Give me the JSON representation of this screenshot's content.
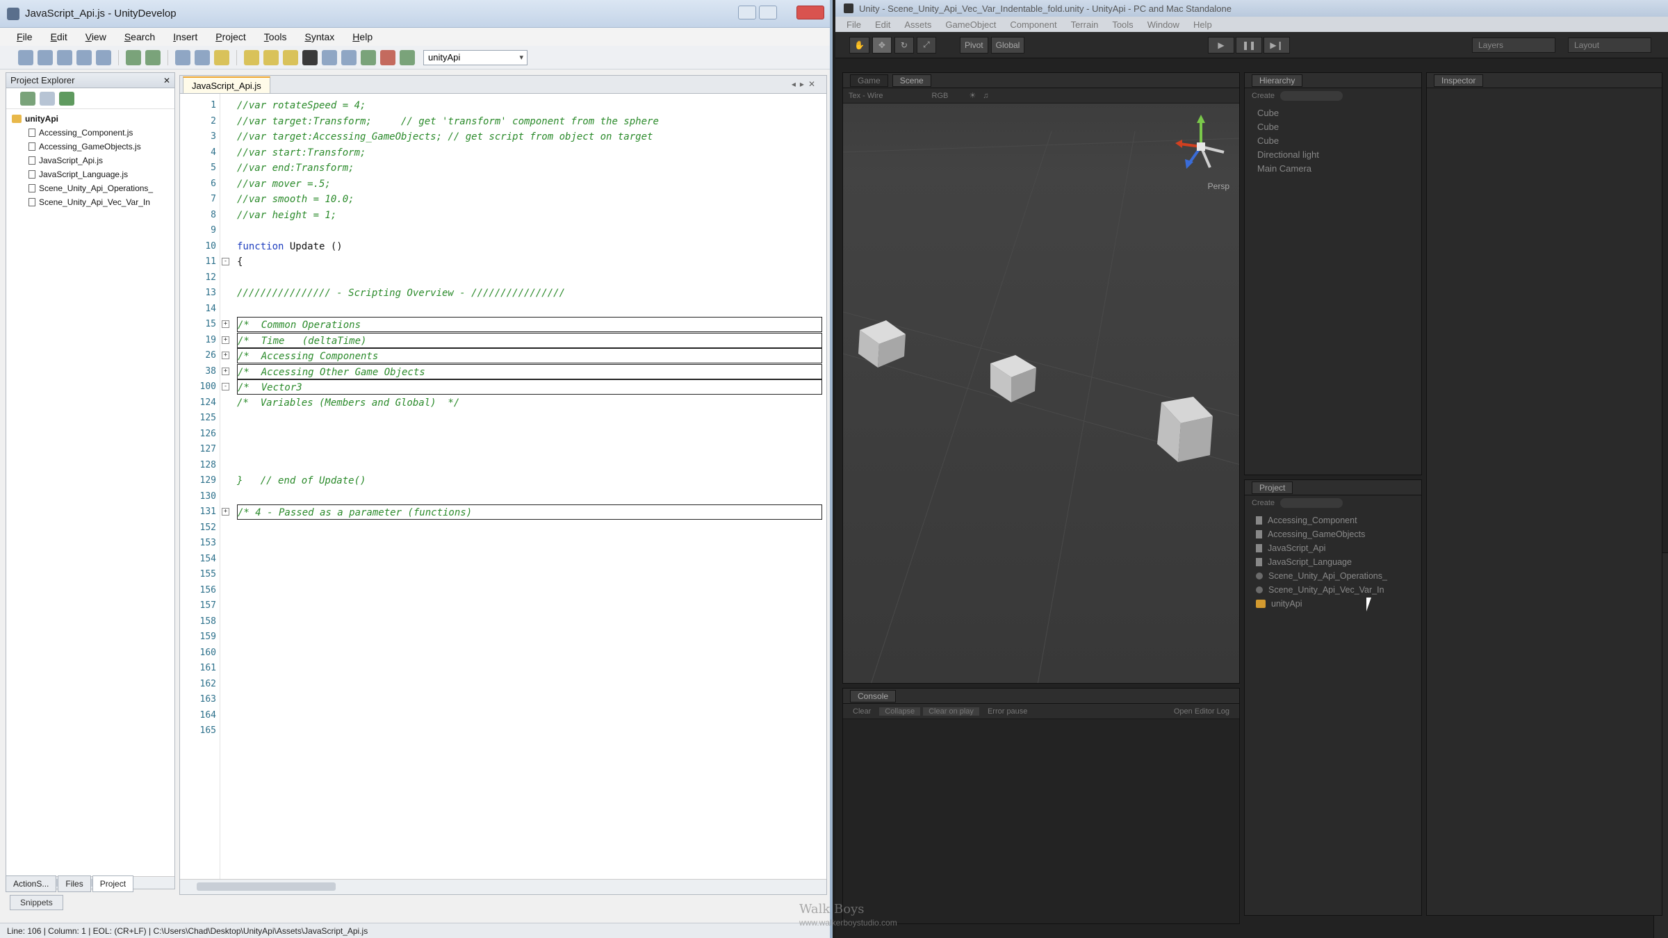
{
  "editor_window": {
    "title": "JavaScript_Api.js - UnityDevelop",
    "menu": [
      "File",
      "Edit",
      "View",
      "Search",
      "Insert",
      "Project",
      "Tools",
      "Syntax",
      "Help"
    ],
    "target_combo": "unityApi",
    "project_explorer": {
      "title": "Project Explorer",
      "root": "unityApi",
      "files": [
        "Accessing_Component.js",
        "Accessing_GameObjects.js",
        "JavaScript_Api.js",
        "JavaScript_Language.js",
        "Scene_Unity_Api_Operations_",
        "Scene_Unity_Api_Vec_Var_In"
      ]
    },
    "bottom_tabs": [
      "ActionS...",
      "Files",
      "Project"
    ],
    "snippets_tab": "Snippets",
    "tab": "JavaScript_Api.js",
    "code_lines": [
      {
        "n": "1",
        "text": "//var rotateSpeed = 4;",
        "kind": "comment"
      },
      {
        "n": "2",
        "text": "//var target:Transform;     // get 'transform' component from the sphere",
        "kind": "comment"
      },
      {
        "n": "3",
        "text": "//var target:Accessing_GameObjects; // get script from object on target",
        "kind": "comment"
      },
      {
        "n": "4",
        "text": "//var start:Transform;",
        "kind": "comment"
      },
      {
        "n": "5",
        "text": "//var end:Transform;",
        "kind": "comment"
      },
      {
        "n": "6",
        "text": "//var mover =.5;",
        "kind": "comment"
      },
      {
        "n": "7",
        "text": "//var smooth = 10.0;",
        "kind": "comment"
      },
      {
        "n": "8",
        "text": "//var height = 1;",
        "kind": "comment"
      },
      {
        "n": "9",
        "text": "",
        "kind": "plain"
      },
      {
        "n": "10",
        "kw": "function",
        "text": " Update ()",
        "kind": "kw"
      },
      {
        "n": "11",
        "text": "{",
        "kind": "plain",
        "fold": "-"
      },
      {
        "n": "12",
        "text": "",
        "kind": "plain"
      },
      {
        "n": "13",
        "text": "//////////////// - Scripting Overview - ////////////////",
        "kind": "comment"
      },
      {
        "n": "14",
        "text": "",
        "kind": "plain"
      },
      {
        "n": "15",
        "text": "/*  Common Operations",
        "kind": "fold",
        "fold": "+"
      },
      {
        "n": "19",
        "text": "/*  Time   (deltaTime)",
        "kind": "fold",
        "fold": "+"
      },
      {
        "n": "26",
        "text": "/*  Accessing Components",
        "kind": "fold",
        "fold": "+"
      },
      {
        "n": "38",
        "text": "/*  Accessing Other Game Objects",
        "kind": "fold",
        "fold": "+"
      },
      {
        "n": "100",
        "text": "/*  Vector3",
        "kind": "fold",
        "fold": "-"
      },
      {
        "n": "124",
        "text": "/*  Variables (Members and Global)  */",
        "kind": "comment"
      },
      {
        "n": "125",
        "text": "",
        "kind": "plain"
      },
      {
        "n": "126",
        "text": "",
        "kind": "plain"
      },
      {
        "n": "127",
        "text": "",
        "kind": "plain"
      },
      {
        "n": "128",
        "text": "",
        "kind": "plain"
      },
      {
        "n": "129",
        "text": "}   // end of Update()",
        "kind": "mixed"
      },
      {
        "n": "130",
        "text": "",
        "kind": "plain"
      },
      {
        "n": "131",
        "text": "/* 4 - Passed as a parameter (functions)",
        "kind": "fold",
        "fold": "+"
      },
      {
        "n": "152",
        "text": "",
        "kind": "plain"
      },
      {
        "n": "153",
        "text": "",
        "kind": "plain"
      },
      {
        "n": "154",
        "text": "",
        "kind": "plain"
      },
      {
        "n": "155",
        "text": "",
        "kind": "plain"
      },
      {
        "n": "156",
        "text": "",
        "kind": "plain"
      },
      {
        "n": "157",
        "text": "",
        "kind": "plain"
      },
      {
        "n": "158",
        "text": "",
        "kind": "plain"
      },
      {
        "n": "159",
        "text": "",
        "kind": "plain"
      },
      {
        "n": "160",
        "text": "",
        "kind": "plain"
      },
      {
        "n": "161",
        "text": "",
        "kind": "plain"
      },
      {
        "n": "162",
        "text": "",
        "kind": "plain"
      },
      {
        "n": "163",
        "text": "",
        "kind": "plain"
      },
      {
        "n": "164",
        "text": "",
        "kind": "plain"
      },
      {
        "n": "165",
        "text": "",
        "kind": "plain"
      }
    ],
    "status": "Line: 106  |  Column: 1  |  EOL: (CR+LF)  |  C:\\Users\\Chad\\Desktop\\UnityApi\\Assets\\JavaScript_Api.js"
  },
  "unity_window": {
    "title": "Unity - Scene_Unity_Api_Vec_Var_Indentable_fold.unity - UnityApi - PC and Mac Standalone",
    "menu": [
      "File",
      "Edit",
      "Assets",
      "GameObject",
      "Component",
      "Terrain",
      "Tools",
      "Window",
      "Help"
    ],
    "toolbar": {
      "pivot": "Pivot",
      "global": "Global",
      "layers": "Layers",
      "layout": "Layout"
    },
    "scene_tabs": [
      "Game",
      "Scene"
    ],
    "scene_bar": [
      "Tex - Wire",
      "RGB"
    ],
    "persp_label": "Persp",
    "hierarchy": {
      "tab": "Hierarchy",
      "create": "Create",
      "items": [
        "Cube",
        "Cube",
        "Cube",
        "Directional light",
        "Main Camera"
      ]
    },
    "project": {
      "tab": "Project",
      "create": "Create",
      "items": [
        {
          "name": "Accessing_Component",
          "type": "script"
        },
        {
          "name": "Accessing_GameObjects",
          "type": "script"
        },
        {
          "name": "JavaScript_Api",
          "type": "script"
        },
        {
          "name": "JavaScript_Language",
          "type": "script"
        },
        {
          "name": "Scene_Unity_Api_Operations_",
          "type": "scene"
        },
        {
          "name": "Scene_Unity_Api_Vec_Var_In",
          "type": "scene"
        },
        {
          "name": "unityApi",
          "type": "folder"
        }
      ]
    },
    "inspector_tab": "Inspector",
    "console": {
      "tab": "Console",
      "buttons": [
        "Clear",
        "Collapse",
        "Clear on play",
        "Error pause"
      ],
      "editor_log": "Open Editor Log"
    }
  },
  "watermark": {
    "line1": "Walk Boys",
    "line2": "www.walkerboystudio.com"
  }
}
